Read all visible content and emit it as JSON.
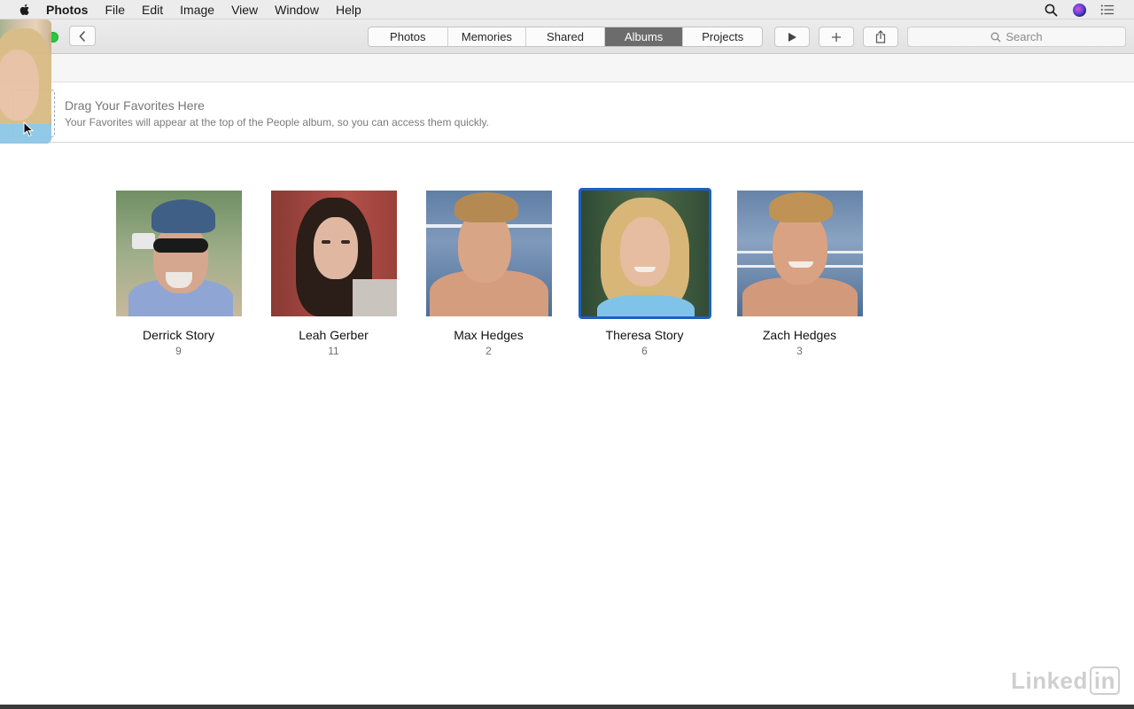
{
  "menubar": {
    "app_name": "Photos",
    "items": [
      "File",
      "Edit",
      "Image",
      "View",
      "Window",
      "Help"
    ]
  },
  "toolbar": {
    "tabs": [
      {
        "label": "Photos",
        "active": false
      },
      {
        "label": "Memories",
        "active": false
      },
      {
        "label": "Shared",
        "active": false
      },
      {
        "label": "Albums",
        "active": true
      },
      {
        "label": "Projects",
        "active": false
      }
    ],
    "search_placeholder": "Search"
  },
  "favorites": {
    "title": "Drag Your Favorites Here",
    "subtitle": "Your Favorites will appear at the top of the People album, so you can access them quickly."
  },
  "people": [
    {
      "name": "Derrick Story",
      "count": "9",
      "selected": false
    },
    {
      "name": "Leah Gerber",
      "count": "11",
      "selected": false
    },
    {
      "name": "Max Hedges",
      "count": "2",
      "selected": false
    },
    {
      "name": "Theresa Story",
      "count": "6",
      "selected": true
    },
    {
      "name": "Zach Hedges",
      "count": "3",
      "selected": false
    }
  ],
  "watermark": {
    "text": "Linked",
    "box": "in"
  },
  "colors": {
    "accent": "#1f5fbf",
    "active_tab": "#6c6c6c",
    "traffic_green": "#2ac840"
  }
}
